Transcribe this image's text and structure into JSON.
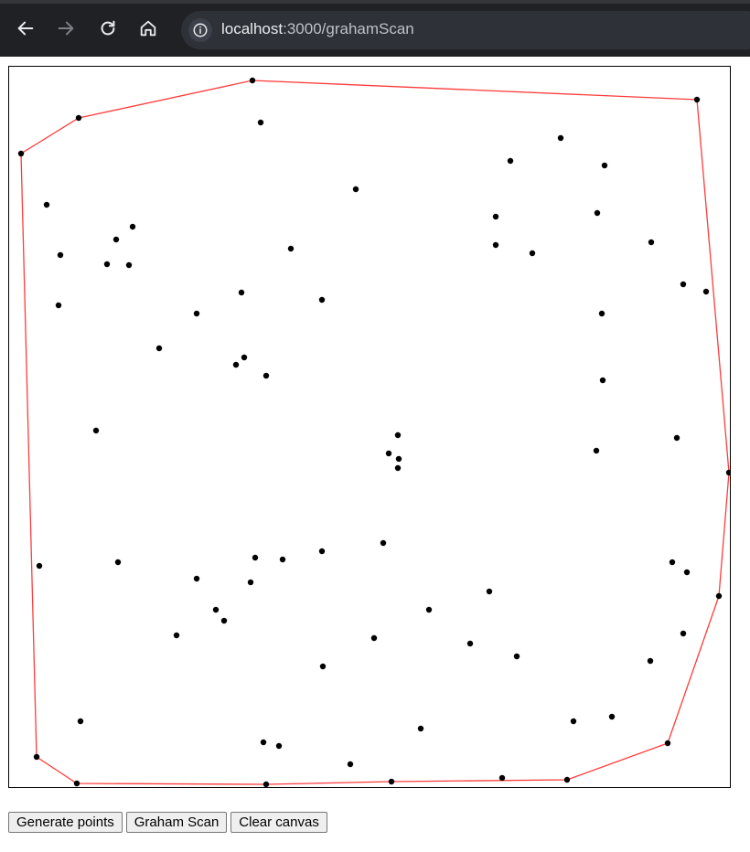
{
  "browser": {
    "url_host": "localhost",
    "url_path": ":3000/grahamScan",
    "icons": [
      "back-icon",
      "forward-icon",
      "reload-icon",
      "home-icon",
      "site-info-icon"
    ],
    "colors": {
      "toolbar": "#202124",
      "omnibox": "#2e3138"
    }
  },
  "controls": {
    "generate_label": "Generate points",
    "graham_label": "Graham Scan",
    "clear_label": "Clear canvas"
  },
  "scatter": {
    "point_color": "#000000",
    "hull_color": "#ff3b3b",
    "points": [
      [
        266,
        15
      ],
      [
        752,
        36
      ],
      [
        76,
        56
      ],
      [
        275,
        61
      ],
      [
        13,
        95
      ],
      [
        603,
        78
      ],
      [
        548,
        103
      ],
      [
        651,
        108
      ],
      [
        379,
        134
      ],
      [
        41,
        151
      ],
      [
        532,
        164
      ],
      [
        643,
        160
      ],
      [
        135,
        175
      ],
      [
        117,
        189
      ],
      [
        308,
        199
      ],
      [
        532,
        195
      ],
      [
        572,
        204
      ],
      [
        702,
        192
      ],
      [
        56,
        206
      ],
      [
        107,
        216
      ],
      [
        131,
        217
      ],
      [
        737,
        238
      ],
      [
        762,
        246
      ],
      [
        254,
        247
      ],
      [
        342,
        255
      ],
      [
        54,
        261
      ],
      [
        205,
        270
      ],
      [
        648,
        270
      ],
      [
        164,
        308
      ],
      [
        257,
        318
      ],
      [
        248,
        326
      ],
      [
        281,
        338
      ],
      [
        649,
        343
      ],
      [
        95,
        398
      ],
      [
        425,
        403
      ],
      [
        415,
        423
      ],
      [
        426,
        429
      ],
      [
        425,
        439
      ],
      [
        642,
        420
      ],
      [
        730,
        406
      ],
      [
        787,
        444
      ],
      [
        33,
        546
      ],
      [
        119,
        542
      ],
      [
        269,
        537
      ],
      [
        299,
        539
      ],
      [
        342,
        530
      ],
      [
        409,
        521
      ],
      [
        205,
        560
      ],
      [
        264,
        564
      ],
      [
        525,
        574
      ],
      [
        725,
        542
      ],
      [
        741,
        553
      ],
      [
        226,
        594
      ],
      [
        235,
        606
      ],
      [
        459,
        594
      ],
      [
        776,
        579
      ],
      [
        183,
        622
      ],
      [
        399,
        625
      ],
      [
        504,
        631
      ],
      [
        555,
        645
      ],
      [
        737,
        620
      ],
      [
        701,
        650
      ],
      [
        343,
        656
      ],
      [
        78,
        716
      ],
      [
        617,
        716
      ],
      [
        659,
        711
      ],
      [
        450,
        724
      ],
      [
        720,
        740
      ],
      [
        278,
        739
      ],
      [
        295,
        743
      ],
      [
        373,
        763
      ],
      [
        30,
        755
      ],
      [
        74,
        784
      ],
      [
        281,
        785
      ],
      [
        418,
        782
      ],
      [
        539,
        778
      ],
      [
        610,
        780
      ]
    ],
    "hull": [
      [
        266,
        15
      ],
      [
        752,
        36
      ],
      [
        787,
        444
      ],
      [
        776,
        579
      ],
      [
        720,
        740
      ],
      [
        610,
        780
      ],
      [
        418,
        782
      ],
      [
        281,
        785
      ],
      [
        74,
        784
      ],
      [
        30,
        755
      ],
      [
        13,
        95
      ],
      [
        76,
        56
      ]
    ]
  }
}
